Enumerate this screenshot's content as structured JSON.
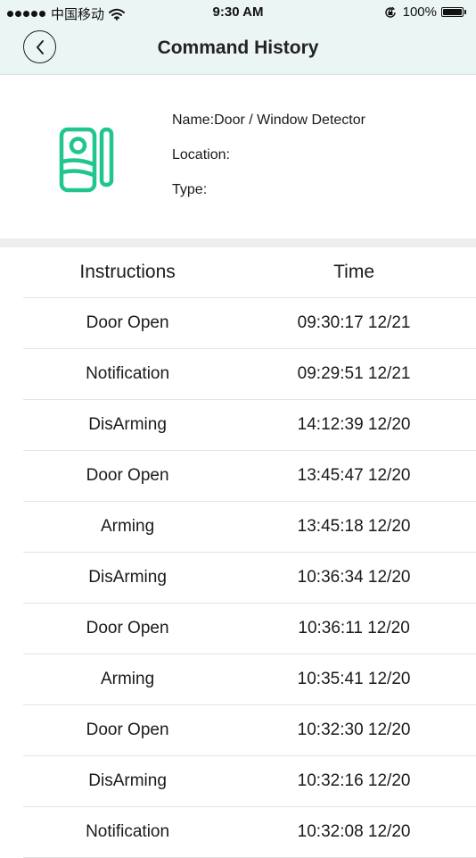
{
  "status_bar": {
    "carrier": "中国移动",
    "time": "9:30 AM",
    "battery": "100%"
  },
  "nav": {
    "title": "Command History"
  },
  "device": {
    "name_line": "Name:Door / Window Detector",
    "location_line": "Location:",
    "type_line": "Type:",
    "icon": "door-window-sensor-icon",
    "icon_color": "#21c58e"
  },
  "table": {
    "headers": {
      "instructions": "Instructions",
      "time": "Time"
    },
    "rows": [
      {
        "instruction": "Door Open",
        "time": "09:30:17 12/21"
      },
      {
        "instruction": "Notification",
        "time": "09:29:51 12/21"
      },
      {
        "instruction": "DisArming",
        "time": "14:12:39 12/20"
      },
      {
        "instruction": "Door Open",
        "time": "13:45:47 12/20"
      },
      {
        "instruction": "Arming",
        "time": "13:45:18 12/20"
      },
      {
        "instruction": "DisArming",
        "time": "10:36:34 12/20"
      },
      {
        "instruction": "Door Open",
        "time": "10:36:11 12/20"
      },
      {
        "instruction": "Arming",
        "time": "10:35:41 12/20"
      },
      {
        "instruction": "Door Open",
        "time": "10:32:30 12/20"
      },
      {
        "instruction": "DisArming",
        "time": "10:32:16 12/20"
      },
      {
        "instruction": "Notification",
        "time": "10:32:08 12/20"
      }
    ]
  },
  "colors": {
    "nav_background": "#ebf6f4",
    "divider": "#e4e4e4",
    "section_gap": "#eeeeee"
  }
}
